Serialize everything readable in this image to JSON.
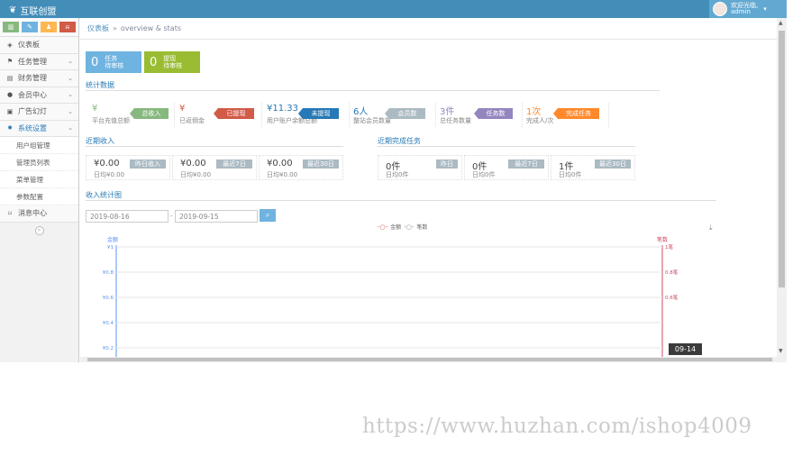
{
  "brand": {
    "name": "互联创盟"
  },
  "user": {
    "greeting": "欢迎光临,",
    "name": "admin"
  },
  "colors": {
    "topbar": "#438eb9",
    "accent": "#2679b5",
    "green": "#87b87f",
    "red": "#d15b47",
    "blue": "#6fb3e0",
    "purple": "#9585bf",
    "orange": "#ff892a",
    "grey": "#abbac3"
  },
  "sidebar": {
    "shortcuts": [
      {
        "icon": "signal-icon",
        "color": "#87b87f"
      },
      {
        "icon": "pencil-icon",
        "color": "#6fb3e0"
      },
      {
        "icon": "users-icon",
        "color": "#ffb752"
      },
      {
        "icon": "bell-icon",
        "color": "#d15b47"
      }
    ],
    "items": [
      {
        "label": "仪表板",
        "icon": "dashboard-icon",
        "glyph": "◈"
      },
      {
        "label": "任务管理",
        "icon": "flag-icon",
        "glyph": "⚑",
        "arrow": "⌄"
      },
      {
        "label": "财务管理",
        "icon": "calculator-icon",
        "glyph": "▤",
        "arrow": "⌄"
      },
      {
        "label": "会员中心",
        "icon": "user-icon",
        "glyph": "●",
        "arrow": "⌄"
      },
      {
        "label": "广告幻灯",
        "icon": "picture-icon",
        "glyph": "▣",
        "arrow": "⌄"
      },
      {
        "label": "系统设置",
        "icon": "cog-icon",
        "glyph": "✹",
        "arrow": "⌄"
      }
    ],
    "subitems": [
      "用户组管理",
      "管理员列表",
      "菜单管理",
      "参数配置"
    ],
    "message_center": {
      "label": "消息中心",
      "glyph": "⌑"
    }
  },
  "breadcrumb": {
    "home": "仪表板",
    "sep": "»",
    "sub": "overview & stats"
  },
  "counters": [
    {
      "num": "0",
      "line1": "任务",
      "line2": "待审核",
      "color": "#6fb3e0"
    },
    {
      "num": "0",
      "line1": "提现",
      "line2": "待审核",
      "color": "#9abc32"
    }
  ],
  "stats": {
    "title": "统计数据",
    "items": [
      {
        "value": "¥",
        "desc": "平台充值总额",
        "tag": "总收入",
        "color": "#87b87f"
      },
      {
        "value": "¥",
        "desc": "已返佣金",
        "tag": "已提现",
        "color": "#d15b47"
      },
      {
        "value": "¥11.33",
        "desc": "用户账户余额总额",
        "tag": "未提现",
        "color": "#2679b5"
      },
      {
        "value": "6人",
        "desc": "整站会员数量",
        "tag": "会员数",
        "color": "#abbac3"
      },
      {
        "value": "3件",
        "desc": "总任务数量",
        "tag": "任务数",
        "color": "#9585bf"
      },
      {
        "value": "1次",
        "desc": "完成人/次",
        "tag": "完成任务",
        "color": "#ff892a"
      }
    ]
  },
  "recent_income": {
    "title": "近期收入",
    "items": [
      {
        "value": "¥0.00",
        "desc": "日均¥0.00",
        "tag": "昨日收入"
      },
      {
        "value": "¥0.00",
        "desc": "日均¥0.00",
        "tag": "最近7日"
      },
      {
        "value": "¥0.00",
        "desc": "日均¥0.00",
        "tag": "最近30日"
      }
    ]
  },
  "recent_tasks": {
    "title": "近期完成任务",
    "items": [
      {
        "value": "0件",
        "desc": "日均0件",
        "tag": "昨日"
      },
      {
        "value": "0件",
        "desc": "日均0件",
        "tag": "最近7日"
      },
      {
        "value": "1件",
        "desc": "日均0件",
        "tag": "最近30日"
      }
    ]
  },
  "income_chart": {
    "title": "收入统计图",
    "date_from": "2019-08-16",
    "date_sep": "-",
    "date_to": "2019-09-15",
    "search_icon": "search-icon",
    "legend": [
      {
        "name": "金额",
        "color": "#d15b47"
      },
      {
        "name": "笔数",
        "color": "#888"
      }
    ],
    "download_icon": "download-icon",
    "tooltip": "09-14"
  },
  "chart_data": {
    "type": "line",
    "title": "",
    "xlabel": "",
    "ylabel": "金额",
    "y2label": "笔数",
    "y_ticks": [
      "¥1",
      "¥0.8",
      "¥0.6",
      "¥0.4",
      "¥0.2"
    ],
    "y2_ticks": [
      "1笔",
      "0.8笔",
      "0.6笔"
    ],
    "ylim": [
      0,
      1
    ],
    "y2lim": [
      0,
      1
    ],
    "grid": true,
    "legend": "top-center",
    "series": [
      {
        "name": "金额",
        "values": []
      },
      {
        "name": "笔数",
        "values": []
      }
    ]
  },
  "watermark": "https://www.huzhan.com/ishop4009"
}
